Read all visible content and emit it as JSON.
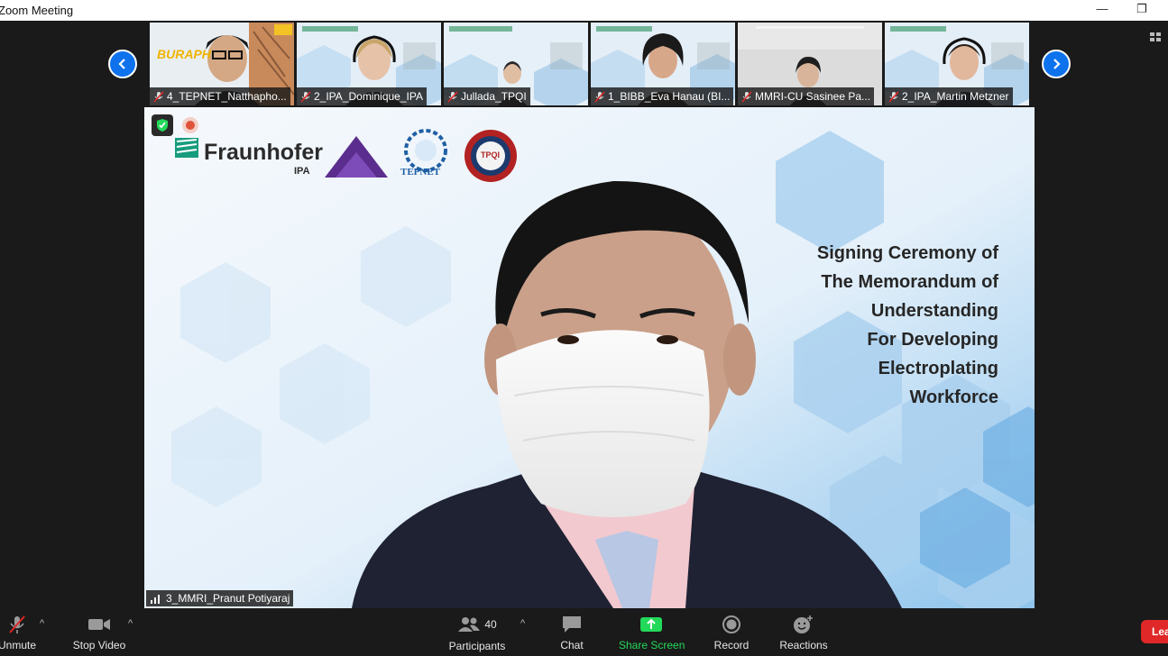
{
  "window": {
    "title": "Zoom Meeting",
    "minimize": "—",
    "restore": "❐"
  },
  "gallery": {
    "prev_arrow": "‹",
    "next_arrow": "›",
    "participants": [
      {
        "name": "4_TEPNET_Natthapho..."
      },
      {
        "name": "2_IPA_Dominique_IPA"
      },
      {
        "name": "Jullada_TPQI"
      },
      {
        "name": "1_BIBB_Eva Hanau (BI..."
      },
      {
        "name": "MMRI-CU Sasinee Pa..."
      },
      {
        "name": "2_IPA_Martin Metzner"
      }
    ],
    "thumb_banner_text": "BURAPH UNIVERS"
  },
  "main": {
    "speaker_name": "3_MMRI_Pranut Potiyaraj",
    "slide": {
      "logo_fraunhofer": "Fraunhofer",
      "logo_fraunhofer_sub": "IPA",
      "logo_tepnet": "TEPNET",
      "logo_tpqi": "TPQI",
      "title_lines": [
        "Signing Ceremony of",
        "The Memorandum of",
        "Understanding",
        "For Developing",
        "Electroplating",
        "Workforce"
      ]
    }
  },
  "toolbar": {
    "unmute": "Unmute",
    "stop_video": "Stop Video",
    "participants_count": "40",
    "participants": "Participants",
    "chat": "Chat",
    "share_screen": "Share Screen",
    "record": "Record",
    "reactions": "Reactions",
    "leave": "Lea"
  },
  "colors": {
    "accent_blue": "#0e72ed",
    "share_green": "#23d959",
    "leave_red": "#e02828",
    "muted_red": "#e02828"
  }
}
